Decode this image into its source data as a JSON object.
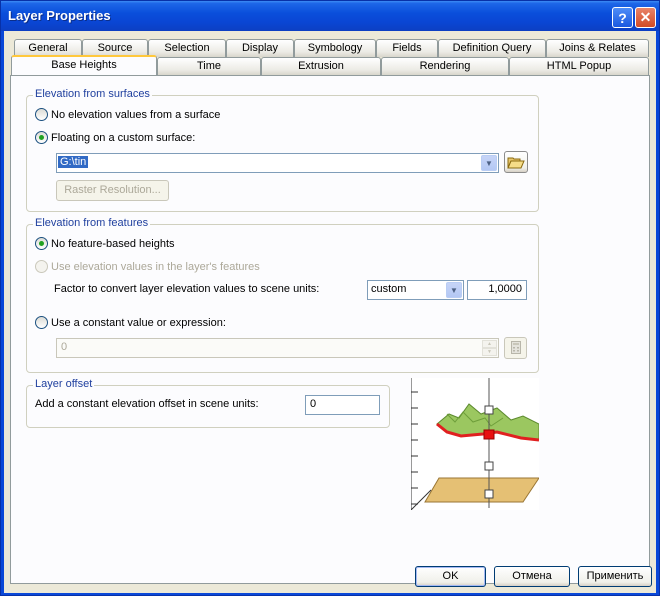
{
  "window": {
    "title": "Layer Properties"
  },
  "tabs_row1": [
    {
      "label": "General"
    },
    {
      "label": "Source"
    },
    {
      "label": "Selection"
    },
    {
      "label": "Display"
    },
    {
      "label": "Symbology"
    },
    {
      "label": "Fields"
    },
    {
      "label": "Definition Query"
    },
    {
      "label": "Joins & Relates"
    }
  ],
  "tabs_row2": [
    {
      "label": "Base Heights"
    },
    {
      "label": "Time"
    },
    {
      "label": "Extrusion"
    },
    {
      "label": "Rendering"
    },
    {
      "label": "HTML Popup"
    }
  ],
  "surfaces": {
    "title": "Elevation from surfaces",
    "no_elevation_label": "No elevation values from a surface",
    "floating_label": "Floating on a custom surface:",
    "surface_value": "G:\\tin",
    "raster_resolution_label": "Raster Resolution..."
  },
  "features": {
    "title": "Elevation from features",
    "no_heights_label": "No feature-based heights",
    "use_values_label": "Use elevation values in the layer's features",
    "factor_label": "Factor to convert layer elevation values to scene units:",
    "unit_value": "custom",
    "factor_value": "1,0000",
    "constant_label": "Use a constant value or expression:",
    "constant_value": "0"
  },
  "offset": {
    "title": "Layer offset",
    "label": "Add a constant elevation offset in scene units:",
    "value": "0"
  },
  "buttons": {
    "ok": "OK",
    "cancel": "Отмена",
    "apply": "Применить"
  },
  "colors": {
    "titlebar": "#0a4fdb",
    "accent_tab": "#ffc83c",
    "group_title": "#1f3f9e",
    "selection": "#316ac5"
  }
}
